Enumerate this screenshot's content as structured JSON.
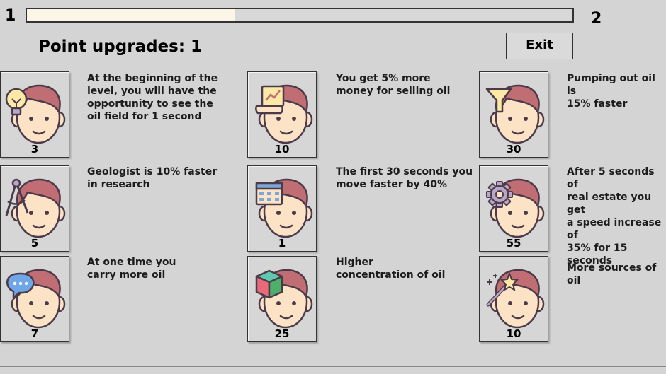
{
  "level": {
    "current": "1",
    "next": "2",
    "progress_fraction": 0.38
  },
  "header": {
    "title": "Point upgrades: 1",
    "exit_label": "Exit"
  },
  "colors": {
    "skin": "#fce3c6",
    "hair": "#c06d73",
    "outline": "#4b3a4a",
    "background": "#d4d4d4",
    "progress_fill": "#fbf6e8"
  },
  "upgrades": [
    {
      "cost": "3",
      "icon": "lightbulb-icon",
      "description": "At the beginning of the\nlevel, you will have the\nopportunity to see the\noil field for 1 second"
    },
    {
      "cost": "10",
      "icon": "chart-scroll-icon",
      "description": "You get 5% more\nmoney for selling oil"
    },
    {
      "cost": "30",
      "icon": "funnel-icon",
      "description": "Pumping out oil is\n15% faster"
    },
    {
      "cost": "5",
      "icon": "compass-icon",
      "description": "Geologist is 10% faster\nin research"
    },
    {
      "cost": "1",
      "icon": "calendar-icon",
      "description": "The first 30 seconds you\nmove faster by 40%"
    },
    {
      "cost": "55",
      "icon": "gear-icon",
      "description": "After 5 seconds of\nreal estate you get\na speed increase of\n35% for 15 seconds"
    },
    {
      "cost": "7",
      "icon": "speech-bubble-icon",
      "description": "At one time you\ncarry more oil"
    },
    {
      "cost": "25",
      "icon": "cube-icon",
      "description": "Higher\nconcentration of oil"
    },
    {
      "cost": "10",
      "icon": "magic-wand-icon",
      "description": "More sources of oil"
    }
  ]
}
